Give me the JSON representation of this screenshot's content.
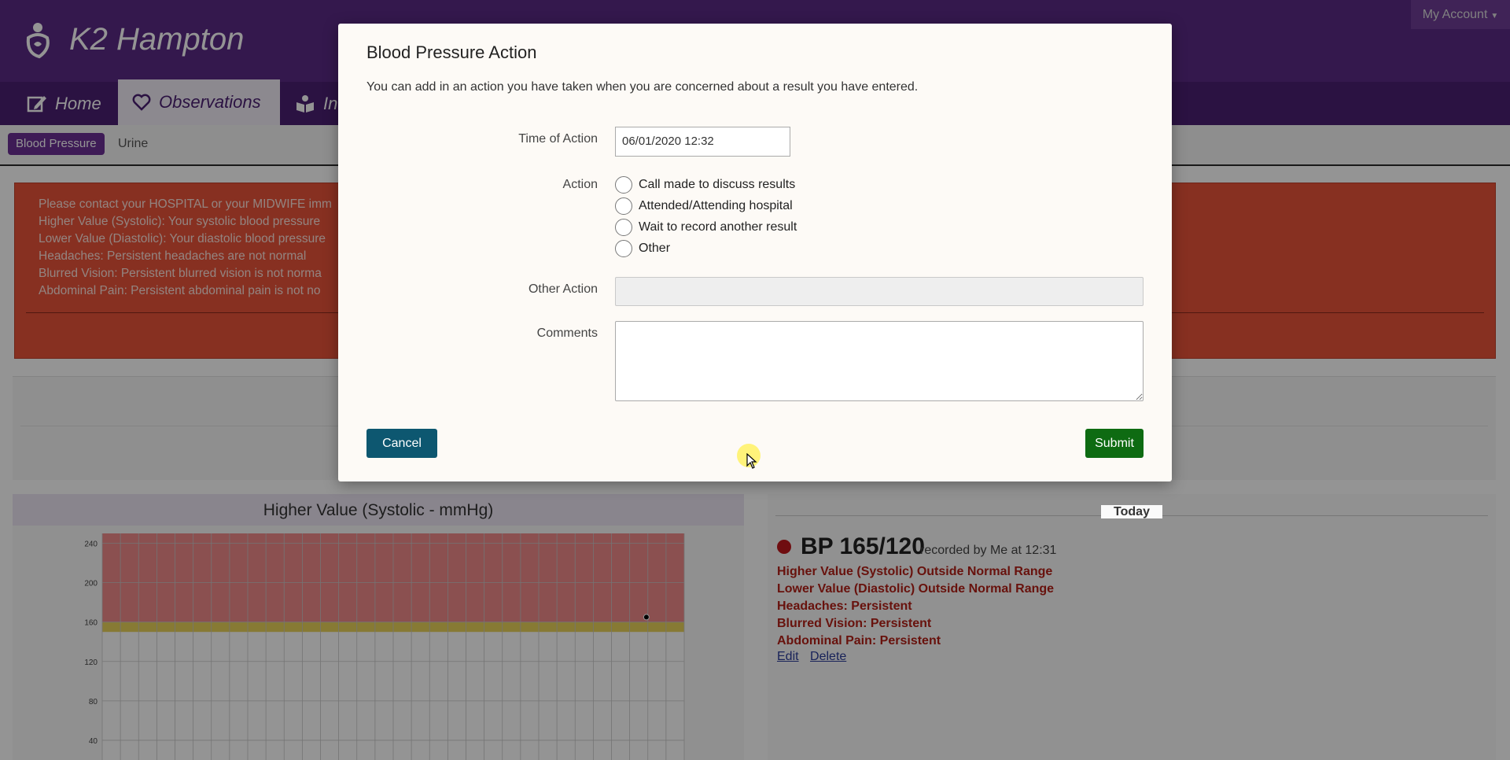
{
  "header": {
    "app_title": "K2 Hampton",
    "account_label": "My Account"
  },
  "nav": {
    "tabs": [
      {
        "label": "Home",
        "icon": "edit-icon"
      },
      {
        "label": "Observations",
        "icon": "heart-icon",
        "active": true
      },
      {
        "label": "In",
        "icon": "book-reader-icon"
      }
    ]
  },
  "subnav": {
    "items": [
      {
        "label": "Blood Pressure",
        "active": true
      },
      {
        "label": "Urine"
      }
    ]
  },
  "alert": {
    "lines": [
      "Please contact your HOSPITAL or your MIDWIFE imm",
      "Higher Value (Systolic): Your systolic blood pressure",
      "Lower Value (Diastolic): Your diastolic blood pressure",
      "Headaches: Persistent headaches are not normal",
      "Blurred Vision: Persistent blurred vision is not norma",
      "Abdominal Pain: Persistent abdominal pain is not no"
    ]
  },
  "chart": {
    "title": "Higher Value (Systolic - mmHg)"
  },
  "chart_data": {
    "type": "scatter",
    "title": "Higher Value (Systolic - mmHg)",
    "xlabel": "",
    "ylabel": "",
    "ylim": [
      20,
      250
    ],
    "yticks": [
      40,
      80,
      120,
      160,
      200,
      240
    ],
    "points": [
      {
        "x_fraction": 0.935,
        "y": 165
      }
    ],
    "danger_band": [
      160,
      250
    ],
    "warning_band": [
      150,
      160
    ],
    "grid": true
  },
  "today": {
    "heading": "Today",
    "reading": "BP 165/120",
    "meta": "recorded by Me at 12:31",
    "issues": [
      "Higher Value (Systolic) Outside Normal Range",
      "Lower Value (Diastolic) Outside Normal Range",
      "Headaches: Persistent",
      "Blurred Vision: Persistent",
      "Abdominal Pain: Persistent"
    ],
    "edit_label": "Edit",
    "delete_label": "Delete"
  },
  "modal": {
    "title": "Blood Pressure Action",
    "description": "You can add in an action you have taken when you are concerned about a result you have entered.",
    "time_label": "Time of Action",
    "time_value": "06/01/2020 12:32",
    "action_label": "Action",
    "actions": [
      "Call made to discuss results",
      "Attended/Attending hospital",
      "Wait to record another result",
      "Other"
    ],
    "other_action_label": "Other Action",
    "comments_label": "Comments",
    "cancel_label": "Cancel",
    "submit_label": "Submit"
  },
  "colors": {
    "brand_purple": "#5b2a86",
    "alert_red": "#e8533a",
    "submit_green": "#0e6b12",
    "cancel_teal": "#0d5770",
    "status_red": "#c0181d"
  }
}
